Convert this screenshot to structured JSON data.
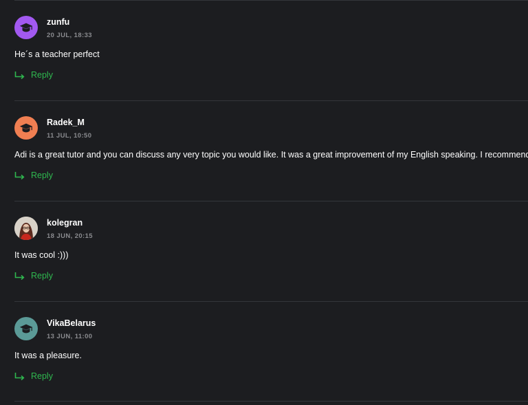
{
  "comments": [
    {
      "username": "zunfu",
      "date": "20 JUL, 18:33",
      "text": "He´s a teacher perfect",
      "reply_label": "Reply",
      "avatar": {
        "type": "icon",
        "icon": "graduation-cap-icon",
        "color": "#a259f0"
      }
    },
    {
      "username": "Radek_M",
      "date": "11 JUL, 10:50",
      "text": "Adi is a great tutor and you can discuss any very topic you would like. It was a great improvement of my English speaking. I recommend",
      "reply_label": "Reply",
      "avatar": {
        "type": "icon",
        "icon": "graduation-cap-icon",
        "color": "#f07f52"
      }
    },
    {
      "username": "kolegran",
      "date": "18 JUN, 20:15",
      "text": "It was cool :)))",
      "reply_label": "Reply",
      "avatar": {
        "type": "photo",
        "icon": "user-photo"
      }
    },
    {
      "username": "VikaBelarus",
      "date": "13 JUN, 11:00",
      "text": "It was a pleasure.",
      "reply_label": "Reply",
      "avatar": {
        "type": "icon",
        "icon": "graduation-cap-icon",
        "color": "#5b9a97"
      }
    }
  ],
  "colors": {
    "background": "#1c1d20",
    "reply_green": "#2fb84f",
    "date_gray": "#8a8b8f",
    "divider": "#34363b"
  }
}
